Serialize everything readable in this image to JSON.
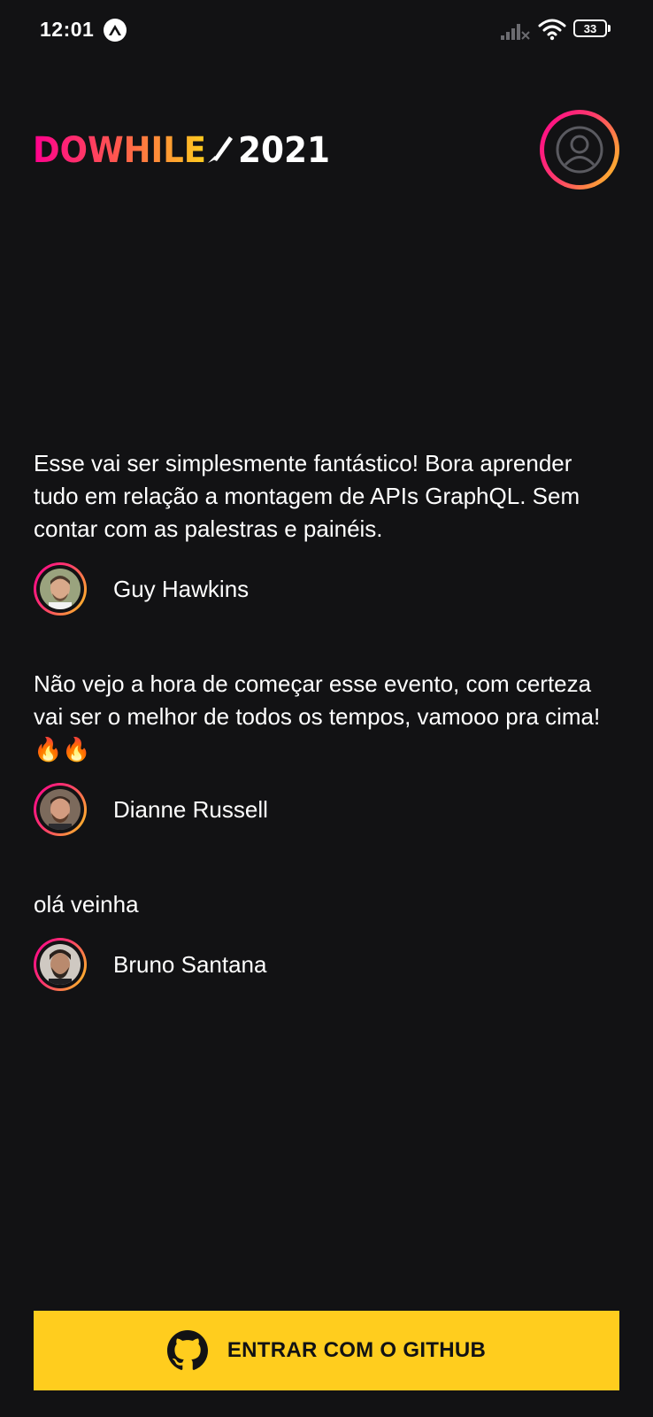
{
  "status_bar": {
    "time": "12:01",
    "app_icon": "expo-icon",
    "signal_icon": "signal-bars-icon",
    "wifi_icon": "wifi-icon",
    "battery_level": "33"
  },
  "header": {
    "logo_alt": "DOWHILE 2021",
    "logo_word_do": "DO",
    "logo_word_while": "WHILE",
    "logo_year": "2021",
    "profile_icon": "user-circle-icon"
  },
  "messages": [
    {
      "text": "Esse vai ser simplesmente fantástico! Bora aprender tudo em relação a montagem de APIs GraphQL. Sem contar com as palestras e painéis.",
      "author": "Guy Hawkins"
    },
    {
      "text": "Não vejo a hora de começar esse evento, com certeza vai ser o melhor de todos os tempos, vamooo pra cima! 🔥🔥",
      "author": "Dianne Russell"
    },
    {
      "text": "olá veinha",
      "author": "Bruno Santana"
    }
  ],
  "signin": {
    "label": "ENTRAR COM O GITHUB",
    "icon": "github-icon"
  },
  "colors": {
    "background": "#121214",
    "accent_yellow": "#ffcd1e",
    "accent_pink": "#ff008e",
    "text": "#ffffff"
  }
}
